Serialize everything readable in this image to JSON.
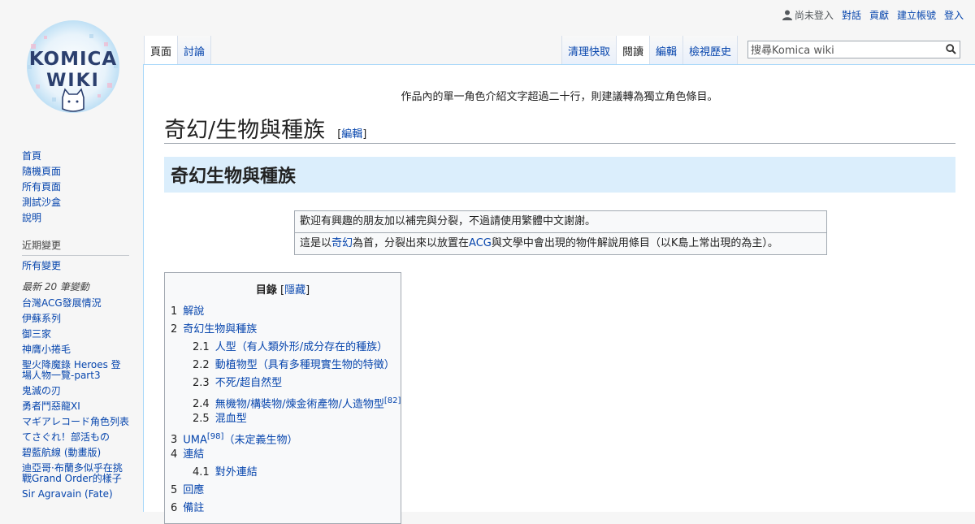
{
  "personal": {
    "not_logged_in": "尚未登入",
    "items": [
      "對話",
      "貢獻",
      "建立帳號",
      "登入"
    ]
  },
  "logo": {
    "line1": "KOMICA",
    "line2": "WIKI"
  },
  "sidebar": {
    "nav": [
      "首頁",
      "隨機頁面",
      "所有頁面",
      "測試沙盒",
      "說明"
    ],
    "recent_header": "近期變更",
    "recent_all": "所有變更",
    "latest_header": "最新 20 筆變動",
    "latest": [
      "台灣ACG發展情況",
      "伊蘇系列",
      "御三家",
      "神膺小捲毛",
      "聖火降魔錄 Heroes 登場人物一覽-part3",
      "鬼滅の刃",
      "勇者鬥惡龍XI",
      "マギアレコード角色列表",
      "てさぐれ！部活もの",
      "碧藍航線 (動畫版)",
      "迪亞哥·布蘭多似乎在挑戰Grand Order的樣子",
      "Sir Agravain (Fate)"
    ]
  },
  "tabs_left": [
    "頁面",
    "討論"
  ],
  "tabs_right": [
    "清理快取",
    "閱讀",
    "編輯",
    "檢視歷史"
  ],
  "search": {
    "placeholder": "搜尋Komica wiki"
  },
  "notice": "作品內的單一角色介紹文字超過二十行，則建議轉為獨立角色條目。",
  "page": {
    "title": "奇幻/生物與種族",
    "edit_open": "[",
    "edit_label": "編輯",
    "edit_close": "]",
    "banner": "奇幻生物與種族"
  },
  "ambox": {
    "row1": "歡迎有興趣的朋友加以補完與分裂，不過請使用繁體中文謝謝。",
    "row2_a": "這是以",
    "row2_link1": "奇幻",
    "row2_b": "為首，分裂出來以放置在",
    "row2_link2": "ACG",
    "row2_c": "與文學中會出現的物件解說用條目（以K島上常出現的為主）。"
  },
  "toc": {
    "title": "目錄",
    "hide_open": " [",
    "hide": "隱藏",
    "hide_close": "]",
    "items": [
      {
        "num": "1",
        "text": "解說"
      },
      {
        "num": "2",
        "text": "奇幻生物與種族"
      },
      {
        "num": "2.1",
        "text": "人型（有人類外形/成分存在的種族）"
      },
      {
        "num": "2.2",
        "text": "動植物型（具有多種現實生物的特徵）"
      },
      {
        "num": "2.3",
        "text": "不死/超自然型"
      },
      {
        "num": "2.4",
        "text": "無機物/構裝物/煉金術產物/人造物型",
        "sup": "[82]"
      },
      {
        "num": "2.5",
        "text": "混血型"
      },
      {
        "num": "3",
        "text": "UMA",
        "sup": "[98]",
        "after": "（未定義生物）"
      },
      {
        "num": "4",
        "text": "連結"
      },
      {
        "num": "4.1",
        "text": "對外連結"
      },
      {
        "num": "5",
        "text": "回應"
      },
      {
        "num": "6",
        "text": "備註"
      }
    ]
  }
}
